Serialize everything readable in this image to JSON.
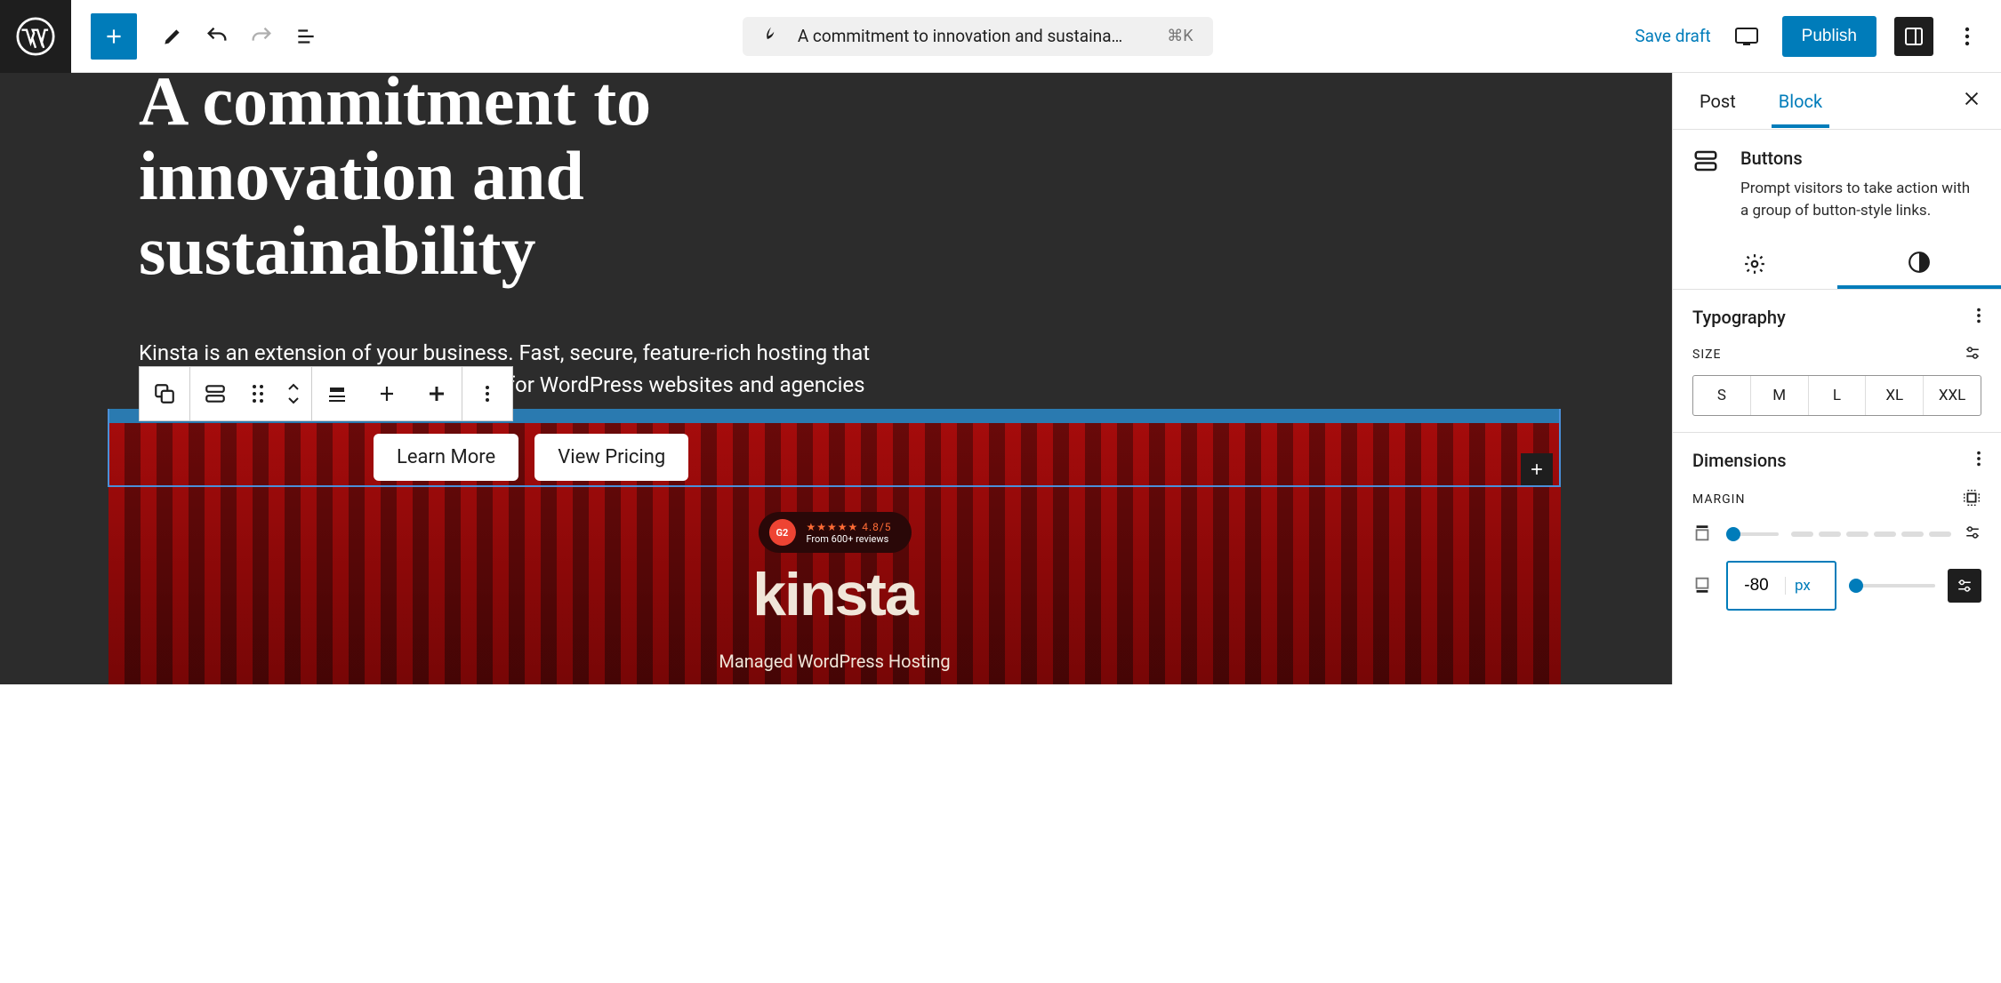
{
  "toolbar": {
    "title_truncated": "A commitment to innovation and sustaina…",
    "shortcut": "⌘K",
    "save_draft": "Save draft",
    "publish": "Publish"
  },
  "canvas": {
    "heading": "A commitment to innovation and sustainability",
    "subheading": "Kinsta is an extension of your business. Fast, secure, feature-rich hosting that makes your work so much easier. Built for WordPress websites and agencies",
    "btn1": "Learn More",
    "btn2": "View Pricing",
    "g2_rating": "★★★★★ 4.8/5",
    "g2_sub": "From 600+ reviews",
    "g2_badge": "G2",
    "kinsta": "kinsta",
    "kinsta_sub": "Managed WordPress Hosting"
  },
  "sidebar": {
    "tabs": {
      "post": "Post",
      "block": "Block"
    },
    "block": {
      "name": "Buttons",
      "desc": "Prompt visitors to take action with a group of button-style links."
    },
    "typography": {
      "title": "Typography",
      "size_label": "SIZE",
      "sizes": [
        "S",
        "M",
        "L",
        "XL",
        "XXL"
      ]
    },
    "dimensions": {
      "title": "Dimensions",
      "margin_label": "MARGIN",
      "value": "-80",
      "unit": "px"
    }
  }
}
